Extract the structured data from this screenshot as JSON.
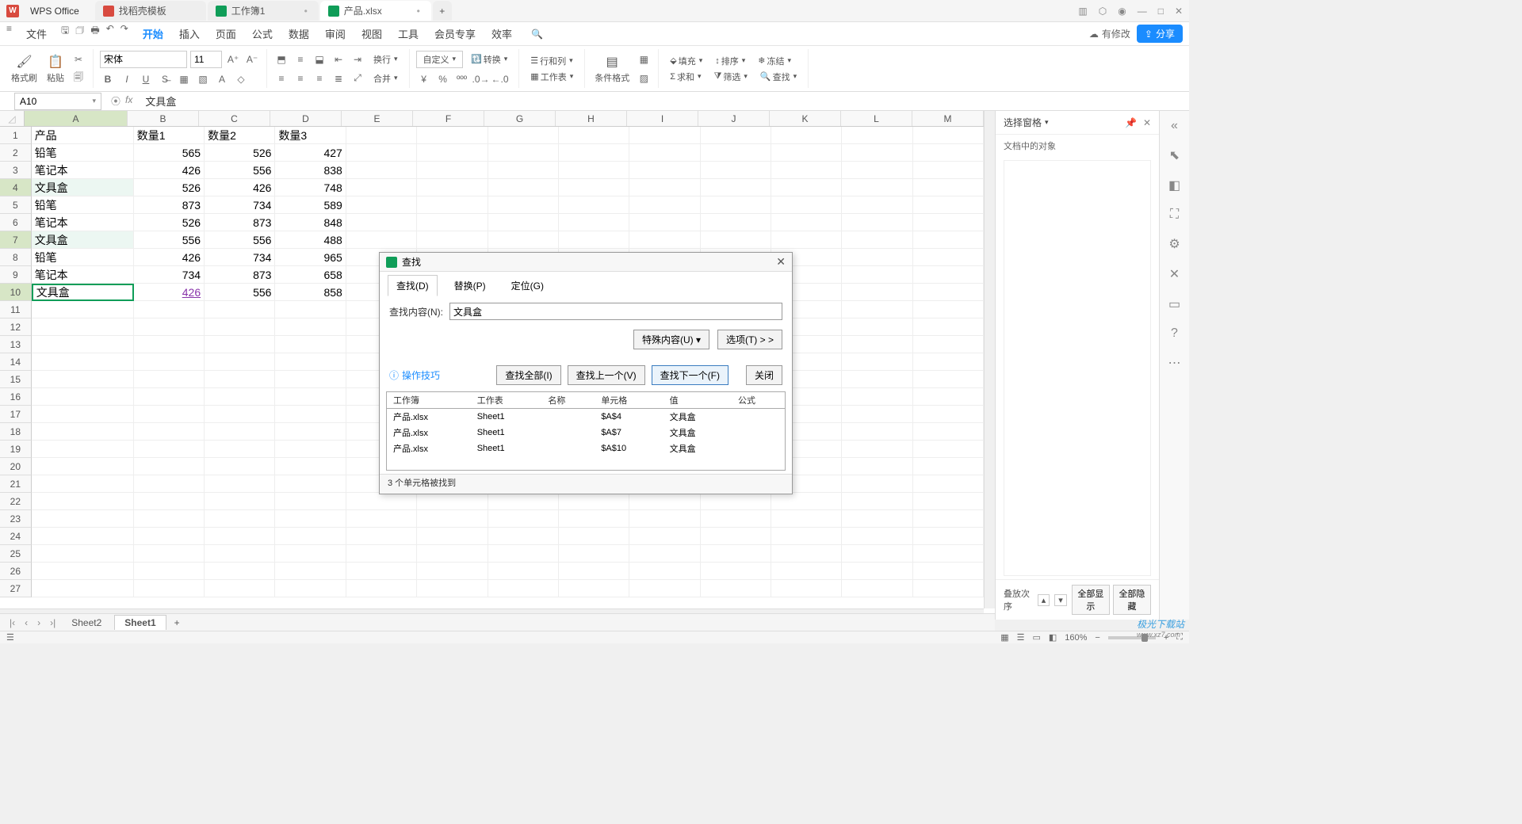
{
  "app_name": "WPS Office",
  "doc_tabs": [
    {
      "label": "找稻壳模板",
      "icon": "red"
    },
    {
      "label": "工作簿1",
      "icon": "green"
    },
    {
      "label": "产品.xlsx",
      "icon": "green",
      "active": true
    }
  ],
  "win_controls": {
    "min": "—",
    "max": "□",
    "close": "✕"
  },
  "menu": {
    "file": "文件",
    "items": [
      "开始",
      "插入",
      "页面",
      "公式",
      "数据",
      "审阅",
      "视图",
      "工具",
      "会员专享",
      "效率"
    ],
    "active": "开始",
    "modify_status": "有修改",
    "share": "分享"
  },
  "ribbon": {
    "format_painter": "格式刷",
    "paste": "粘贴",
    "font_name": "宋体",
    "font_size": "11",
    "wrap": "换行",
    "merge": "合并",
    "number_fmt": "自定义",
    "convert": "转换",
    "rowcol": "行和列",
    "worksheet": "工作表",
    "cond_fmt": "条件格式",
    "fill": "填充",
    "sort": "排序",
    "freeze": "冻结",
    "sum": "求和",
    "filter": "筛选",
    "find": "查找"
  },
  "namebox": "A10",
  "formula_text": "文具盒",
  "columns": [
    "A",
    "B",
    "C",
    "D",
    "E",
    "F",
    "G",
    "H",
    "I",
    "J",
    "K",
    "L",
    "M"
  ],
  "sheet": {
    "headers": {
      "A": "产品",
      "B": "数量1",
      "C": "数量2",
      "D": "数量3"
    },
    "rows": [
      {
        "A": "产品",
        "B": "数量1",
        "C": "数量2",
        "D": "数量3"
      },
      {
        "A": "铅笔",
        "B": "565",
        "C": "526",
        "D": "427"
      },
      {
        "A": "笔记本",
        "B": "426",
        "C": "556",
        "D": "838"
      },
      {
        "A": "文具盒",
        "B": "526",
        "C": "426",
        "D": "748"
      },
      {
        "A": "铅笔",
        "B": "873",
        "C": "734",
        "D": "589"
      },
      {
        "A": "笔记本",
        "B": "526",
        "C": "873",
        "D": "848"
      },
      {
        "A": "文具盒",
        "B": "556",
        "C": "556",
        "D": "488"
      },
      {
        "A": "铅笔",
        "B": "426",
        "C": "734",
        "D": "965"
      },
      {
        "A": "笔记本",
        "B": "734",
        "C": "873",
        "D": "658"
      },
      {
        "A": "文具盒",
        "B": "426",
        "C": "556",
        "D": "858"
      }
    ],
    "highlighted_cells": [
      "A4",
      "A7"
    ],
    "active_cell": "A10",
    "hyperlink_cell": "B10"
  },
  "right_panel": {
    "title": "选择窗格",
    "subtitle": "文档中的对象",
    "stack_order": "叠放次序",
    "show_all": "全部显示",
    "hide_all": "全部隐藏"
  },
  "sheet_tabs": [
    "Sheet2",
    "Sheet1"
  ],
  "active_sheet_tab": "Sheet1",
  "add_sheet": "+",
  "status": {
    "zoom": "160%"
  },
  "find_dialog": {
    "title": "查找",
    "tabs": {
      "find": "查找(D)",
      "replace": "替换(P)",
      "goto": "定位(G)"
    },
    "label_find": "查找内容(N):",
    "value": "文具盒",
    "special": "特殊内容(U) ▾",
    "options": "选项(T) > >",
    "tip": "操作技巧",
    "find_all": "查找全部(I)",
    "find_prev": "查找上一个(V)",
    "find_next": "查找下一个(F)",
    "close": "关闭",
    "cols": {
      "workbook": "工作簿",
      "sheet": "工作表",
      "name": "名称",
      "cell": "单元格",
      "value": "值",
      "formula": "公式"
    },
    "results": [
      {
        "workbook": "产品.xlsx",
        "sheet": "Sheet1",
        "name": "",
        "cell": "$A$4",
        "value": "文具盒",
        "formula": ""
      },
      {
        "workbook": "产品.xlsx",
        "sheet": "Sheet1",
        "name": "",
        "cell": "$A$7",
        "value": "文具盒",
        "formula": ""
      },
      {
        "workbook": "产品.xlsx",
        "sheet": "Sheet1",
        "name": "",
        "cell": "$A$10",
        "value": "文具盒",
        "formula": ""
      }
    ],
    "status": "3 个单元格被找到"
  },
  "watermark": {
    "brand": "极光下载站",
    "url": "www.xz7.com"
  }
}
